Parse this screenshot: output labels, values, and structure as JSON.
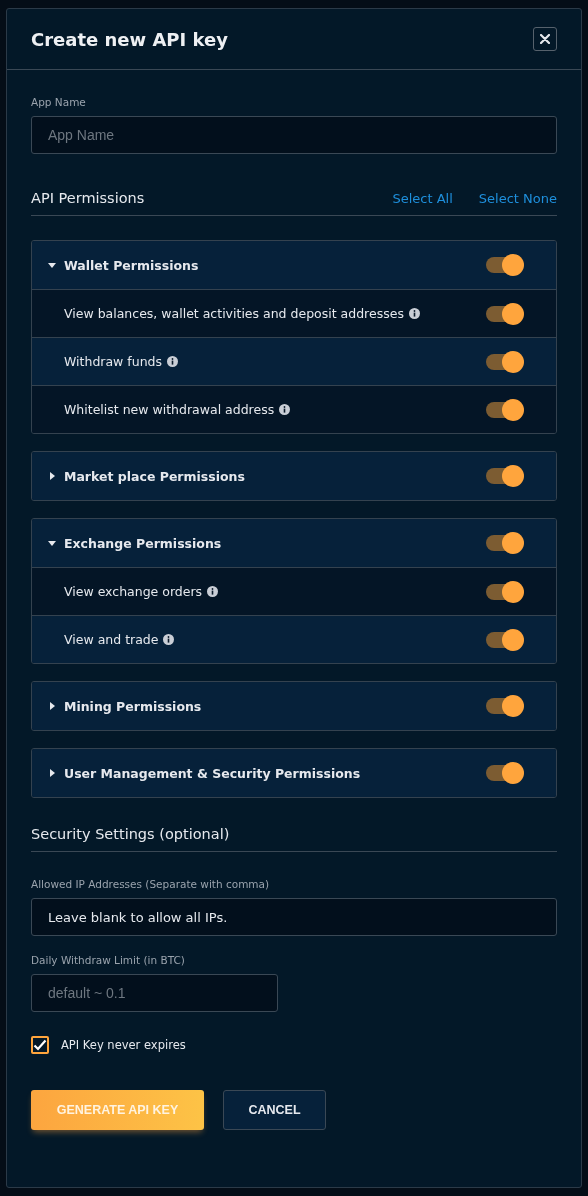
{
  "dialog": {
    "title": "Create new API key"
  },
  "app_name": {
    "label": "App Name",
    "placeholder": "App Name"
  },
  "permissions": {
    "title": "API Permissions",
    "select_all": "Select All",
    "select_none": "Select None",
    "groups": [
      {
        "label": "Wallet Permissions",
        "expanded": true,
        "on": true,
        "items": [
          {
            "label": "View balances, wallet activities and deposit addresses",
            "on": true
          },
          {
            "label": "Withdraw funds",
            "on": true
          },
          {
            "label": "Whitelist new withdrawal address",
            "on": true
          }
        ]
      },
      {
        "label": "Market place Permissions",
        "expanded": false,
        "on": true
      },
      {
        "label": "Exchange Permissions",
        "expanded": true,
        "on": true,
        "items": [
          {
            "label": "View exchange orders",
            "on": true
          },
          {
            "label": "View and trade",
            "on": true
          }
        ]
      },
      {
        "label": "Mining Permissions",
        "expanded": false,
        "on": true
      },
      {
        "label": "User Management & Security Permissions",
        "expanded": false,
        "on": true
      }
    ]
  },
  "security": {
    "title": "Security Settings (optional)",
    "allowed_ips": {
      "label": "Allowed IP Addresses (Separate with comma)",
      "value": "Leave blank to allow all IPs."
    },
    "withdraw_limit": {
      "label": "Daily Withdraw Limit (in BTC)",
      "placeholder": "default ~ 0.1"
    },
    "never_expires": {
      "label": "API Key never expires",
      "checked": true
    }
  },
  "buttons": [
    {
      "label": "GENERATE API KEY",
      "kind": "primary"
    },
    {
      "label": "CANCEL",
      "kind": "secondary"
    }
  ]
}
